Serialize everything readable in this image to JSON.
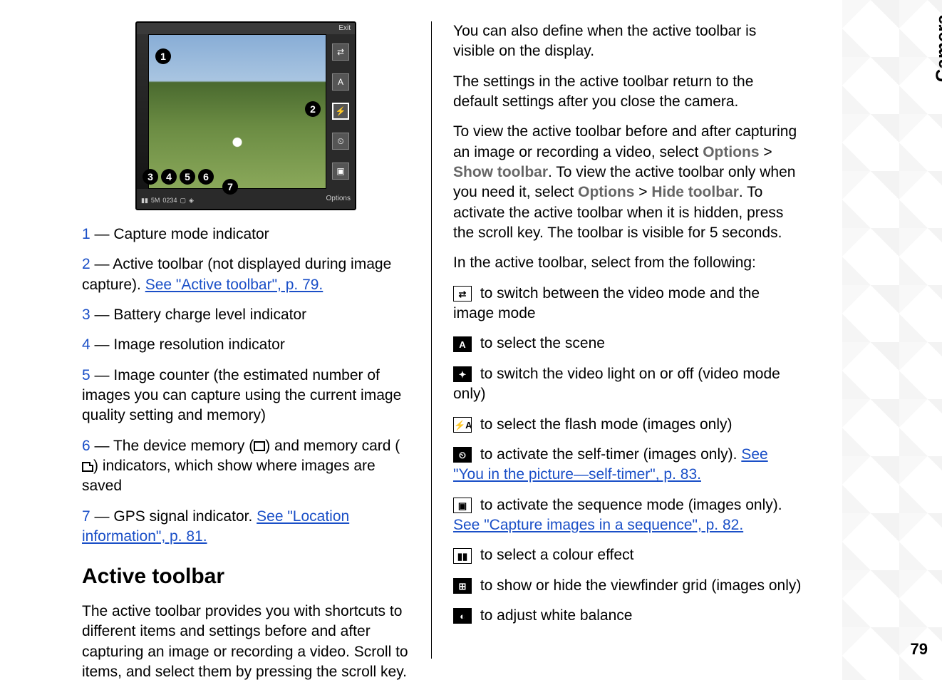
{
  "sideTab": "Camera",
  "pageNumber": "79",
  "camShot": {
    "exit": "Exit",
    "options": "Options",
    "counter": "0234"
  },
  "legend": {
    "i1": {
      "n": "1",
      "text": " — Capture mode indicator"
    },
    "i2a": {
      "n": "2",
      "text": " — Active toolbar (not displayed during image capture). "
    },
    "i2link": "See \"Active toolbar\", p. 79.",
    "i3": {
      "n": "3",
      "text": " — Battery charge level indicator"
    },
    "i4": {
      "n": "4",
      "text": " — Image resolution indicator"
    },
    "i5": {
      "n": "5",
      "text": " — Image counter (the estimated number of images you can capture using the current image quality setting and memory)"
    },
    "i6a": {
      "n": "6",
      "pre": " — The device memory (",
      "mid": ") and memory card (",
      "post": ") indicators, which show where images are saved"
    },
    "i7a": {
      "n": "7",
      "text": " — GPS signal indicator. "
    },
    "i7link": "See \"Location information\", p. 81."
  },
  "sectionHeading": "Active toolbar",
  "leftPara": "The active toolbar provides you with shortcuts to different items and settings before and after capturing an image or recording a video. Scroll to items, and select them by pressing the scroll key.",
  "right": {
    "p1": "You can also define when the active toolbar is visible on the display.",
    "p2": "The settings in the active toolbar return to the default settings after you close the camera.",
    "p3a": "To view the active toolbar before and after capturing an image or recording a video, select ",
    "opt1": "Options",
    "gt": " > ",
    "show": "Show toolbar",
    "p3b": ". To view the active toolbar only when you need it, select ",
    "opt2": "Options",
    "hide": "Hide toolbar",
    "p3c": ". To activate the active toolbar when it is hidden, press the scroll key. The toolbar is visible for 5 seconds.",
    "p4": "In the active toolbar, select from the following:",
    "t1": " to switch between the video mode and the image mode",
    "t2": " to select the scene",
    "t3": " to switch the video light on or off (video mode only)",
    "t4": " to select the flash mode (images only)",
    "t5a": " to activate the self-timer (images only). ",
    "t5link": "See \"You in the picture—self-timer\", p. 83.",
    "t6a": " to activate the sequence mode (images only). ",
    "t6link": "See \"Capture images in a sequence\", p. 82.",
    "t7": " to select a colour effect",
    "t8": " to show or hide the viewfinder grid (images only)",
    "t9": " to adjust white balance"
  },
  "iconGlyphs": {
    "switchMode": "⇄",
    "scene": "A",
    "videoLight": "✦",
    "flash": "⚡A",
    "selfTimer": "⏲",
    "sequence": "▣",
    "colorEffect": "▮▮",
    "grid": "⊞",
    "whiteBalance": "◐"
  }
}
